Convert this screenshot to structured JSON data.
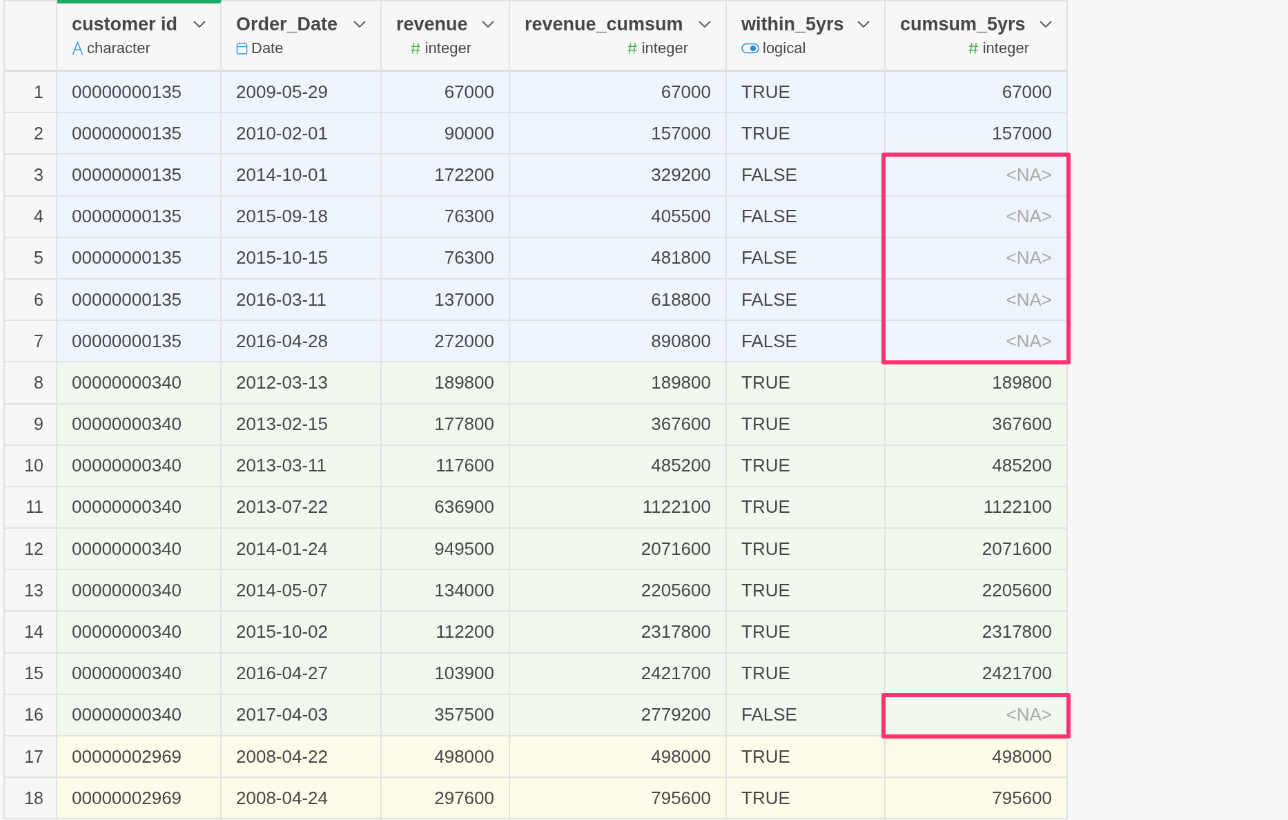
{
  "columns": [
    {
      "name": "customer id",
      "type": "character",
      "kind": "character",
      "selected": true
    },
    {
      "name": "Order_Date",
      "type": "Date",
      "kind": "date",
      "selected": false
    },
    {
      "name": "revenue",
      "type": "integer",
      "kind": "number",
      "selected": false
    },
    {
      "name": "revenue_cumsum",
      "type": "integer",
      "kind": "number",
      "selected": false
    },
    {
      "name": "within_5yrs",
      "type": "logical",
      "kind": "logical",
      "selected": false
    },
    {
      "name": "cumsum_5yrs",
      "type": "integer",
      "kind": "number",
      "selected": false
    }
  ],
  "rows": [
    {
      "num": "1",
      "color": "#eef5fd",
      "cells": [
        "00000000135",
        "2009-05-29",
        "67000",
        "67000",
        "TRUE",
        "67000"
      ],
      "missing": false,
      "flagged": false
    },
    {
      "num": "2",
      "color": "#eef5fd",
      "cells": [
        "00000000135",
        "2010-02-01",
        "90000",
        "157000",
        "TRUE",
        "157000"
      ],
      "missing": false,
      "flagged": false
    },
    {
      "num": "3",
      "color": "#eef5fd",
      "cells": [
        "00000000135",
        "2014-10-01",
        "172200",
        "329200",
        "FALSE",
        "<NA>"
      ],
      "missing": true,
      "flagged": true
    },
    {
      "num": "4",
      "color": "#eef5fd",
      "cells": [
        "00000000135",
        "2015-09-18",
        "76300",
        "405500",
        "FALSE",
        "<NA>"
      ],
      "missing": true,
      "flagged": true
    },
    {
      "num": "5",
      "color": "#eef5fd",
      "cells": [
        "00000000135",
        "2015-10-15",
        "76300",
        "481800",
        "FALSE",
        "<NA>"
      ],
      "missing": true,
      "flagged": true
    },
    {
      "num": "6",
      "color": "#eef5fd",
      "cells": [
        "00000000135",
        "2016-03-11",
        "137000",
        "618800",
        "FALSE",
        "<NA>"
      ],
      "missing": true,
      "flagged": true
    },
    {
      "num": "7",
      "color": "#eef5fd",
      "cells": [
        "00000000135",
        "2016-04-28",
        "272000",
        "890800",
        "FALSE",
        "<NA>"
      ],
      "missing": true,
      "flagged": true
    },
    {
      "num": "8",
      "color": "#f1f8ee",
      "cells": [
        "00000000340",
        "2012-03-13",
        "189800",
        "189800",
        "TRUE",
        "189800"
      ],
      "missing": false,
      "flagged": false
    },
    {
      "num": "9",
      "color": "#f1f8ee",
      "cells": [
        "00000000340",
        "2013-02-15",
        "177800",
        "367600",
        "TRUE",
        "367600"
      ],
      "missing": false,
      "flagged": false
    },
    {
      "num": "10",
      "color": "#f1f8ee",
      "cells": [
        "00000000340",
        "2013-03-11",
        "117600",
        "485200",
        "TRUE",
        "485200"
      ],
      "missing": false,
      "flagged": false
    },
    {
      "num": "11",
      "color": "#f1f8ee",
      "cells": [
        "00000000340",
        "2013-07-22",
        "636900",
        "1122100",
        "TRUE",
        "1122100"
      ],
      "missing": false,
      "flagged": false
    },
    {
      "num": "12",
      "color": "#f1f8ee",
      "cells": [
        "00000000340",
        "2014-01-24",
        "949500",
        "2071600",
        "TRUE",
        "2071600"
      ],
      "missing": false,
      "flagged": false
    },
    {
      "num": "13",
      "color": "#f1f8ee",
      "cells": [
        "00000000340",
        "2014-05-07",
        "134000",
        "2205600",
        "TRUE",
        "2205600"
      ],
      "missing": false,
      "flagged": false
    },
    {
      "num": "14",
      "color": "#f1f8ee",
      "cells": [
        "00000000340",
        "2015-10-02",
        "112200",
        "2317800",
        "TRUE",
        "2317800"
      ],
      "missing": false,
      "flagged": false
    },
    {
      "num": "15",
      "color": "#f1f8ee",
      "cells": [
        "00000000340",
        "2016-04-27",
        "103900",
        "2421700",
        "TRUE",
        "2421700"
      ],
      "missing": false,
      "flagged": false
    },
    {
      "num": "16",
      "color": "#f1f8ee",
      "cells": [
        "00000000340",
        "2017-04-03",
        "357500",
        "2779200",
        "FALSE",
        "<NA>"
      ],
      "missing": true,
      "flagged": true
    },
    {
      "num": "17",
      "color": "#fefbe9",
      "cells": [
        "00000002969",
        "2008-04-22",
        "498000",
        "498000",
        "TRUE",
        "498000"
      ],
      "missing": false,
      "flagged": false
    },
    {
      "num": "18",
      "color": "#fefbe9",
      "cells": [
        "00000002969",
        "2008-04-24",
        "297600",
        "795600",
        "TRUE",
        "795600"
      ],
      "missing": false,
      "flagged": false
    }
  ]
}
